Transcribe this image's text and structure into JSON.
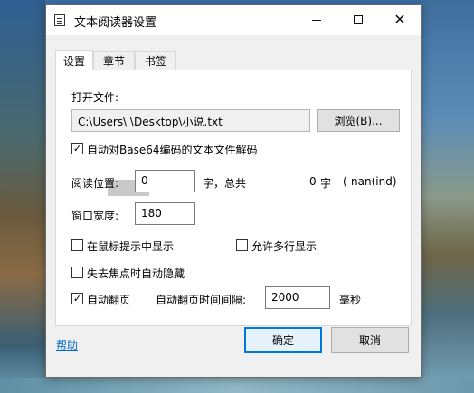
{
  "window": {
    "title": "文本阅读器设置",
    "minimize_glyph": "",
    "maximize_glyph": "",
    "close_glyph": "✕"
  },
  "tabs": [
    {
      "label": "设置",
      "active": true
    },
    {
      "label": "章节",
      "active": false
    },
    {
      "label": "书签",
      "active": false
    }
  ],
  "settings": {
    "open_file_label": "打开文件:",
    "file_path": "C:\\Users\\          \\Desktop\\小说.txt",
    "browse_label": "浏览(B)...",
    "base64_checkbox": {
      "label": "自动对Base64编码的文本文件解码",
      "checked": true
    },
    "read_position_label": "阅读位置:",
    "read_position_value": "0",
    "chars_total_label": "字，总共",
    "total_chars": "0",
    "chars_unit": "字",
    "nan_text": "(-nan(ind)",
    "window_width_label": "窗口宽度:",
    "window_width_value": "180",
    "show_in_tooltip": {
      "label": "在鼠标提示中显示",
      "checked": false
    },
    "allow_multiline": {
      "label": "允许多行显示",
      "checked": false
    },
    "auto_hide": {
      "label": "失去焦点时自动隐藏",
      "checked": false
    },
    "auto_page": {
      "label": "自动翻页",
      "checked": true
    },
    "auto_page_interval_label": "自动翻页时间间隔:",
    "auto_page_interval_value": "2000",
    "ms_unit": "毫秒"
  },
  "footer": {
    "help_label": "帮助",
    "ok_label": "确定",
    "cancel_label": "取消"
  },
  "colors": {
    "accent": "#0078d7",
    "link": "#0066cc"
  }
}
